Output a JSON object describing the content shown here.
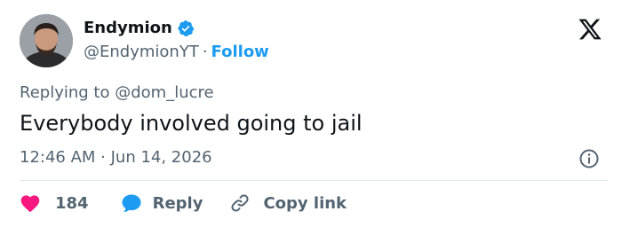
{
  "author": {
    "name": "Endymion",
    "handle": "@EndymionYT",
    "separator": "·",
    "follow_label": "Follow",
    "verified": true,
    "avatar_icon": "avatar-photo"
  },
  "header": {
    "logo_icon": "x-logo-icon"
  },
  "tweet": {
    "replying_prefix": "Replying to",
    "replying_to": "@dom_lucre",
    "text": "Everybody involved going to jail",
    "timestamp": "12:46 AM · Jun 14, 2026"
  },
  "actions": {
    "like_count": "184",
    "reply_label": "Reply",
    "copy_label": "Copy link"
  },
  "colors": {
    "accent": "#1d9bf0",
    "like": "#f91880",
    "text": "#0f1419",
    "secondary": "#536471",
    "divider": "#e1e8ed"
  }
}
